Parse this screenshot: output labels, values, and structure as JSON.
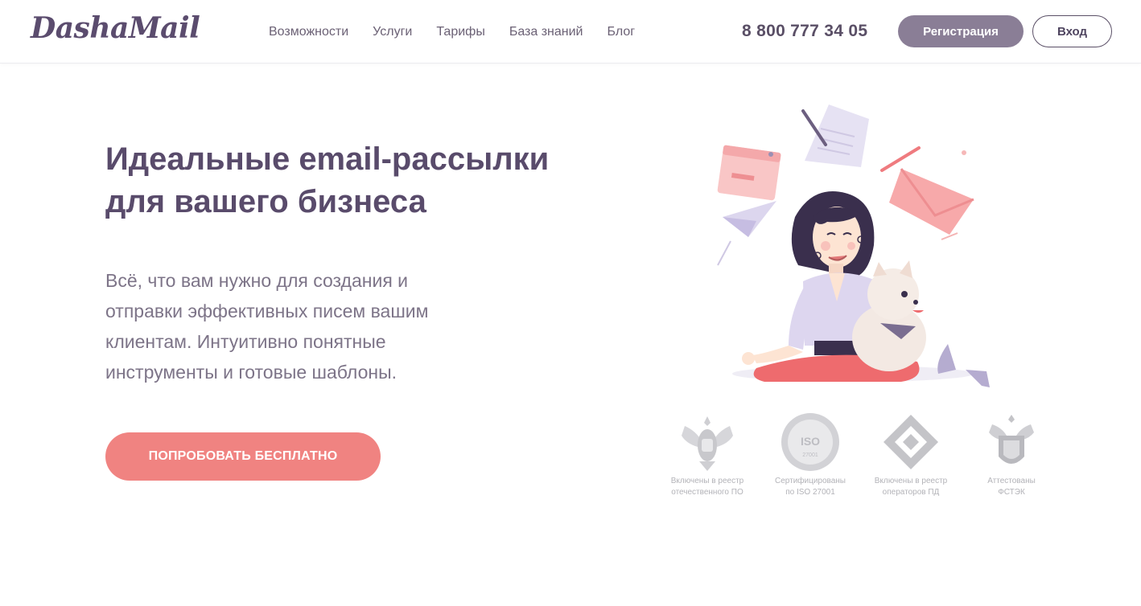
{
  "header": {
    "logo": "DashaMail",
    "nav": [
      "Возможности",
      "Услуги",
      "Тарифы",
      "База знаний",
      "Блог"
    ],
    "phone": "8 800 777 34 05",
    "register_label": "Регистрация",
    "login_label": "Вход"
  },
  "hero": {
    "title_line1": "Идеальные email-рассылки",
    "title_line2": "для вашего бизнеса",
    "subtitle_line1": "Всё, что вам нужно для создания и",
    "subtitle_line2": "отправки эффективных писем вашим",
    "subtitle_line3": "клиентам. Интуитивно понятные",
    "subtitle_line4": "инструменты и готовые шаблоны.",
    "cta_label": "ПОПРОБОВАТЬ БЕСПЛАТНО"
  },
  "certificates": [
    {
      "icon": "russian-coat-of-arms-icon",
      "line1": "Включены в реестр",
      "line2": "отечественного ПО"
    },
    {
      "icon": "iso-seal-icon",
      "line1": "Сертифицированы",
      "line2": "по ISO 27001",
      "seal_text": "ISO",
      "seal_code": "27001"
    },
    {
      "icon": "registry-diamond-icon",
      "line1": "Включены в реестр",
      "line2": "операторов ПД"
    },
    {
      "icon": "fstek-emblem-icon",
      "line1": "Аттестованы",
      "line2": "ФСТЭК"
    }
  ],
  "colors": {
    "brand": "#5b4c6e",
    "register_button": "#8a7e96",
    "cta": "#f08381",
    "text_muted": "#7d7488",
    "cert_gray": "#c4c4c8"
  }
}
